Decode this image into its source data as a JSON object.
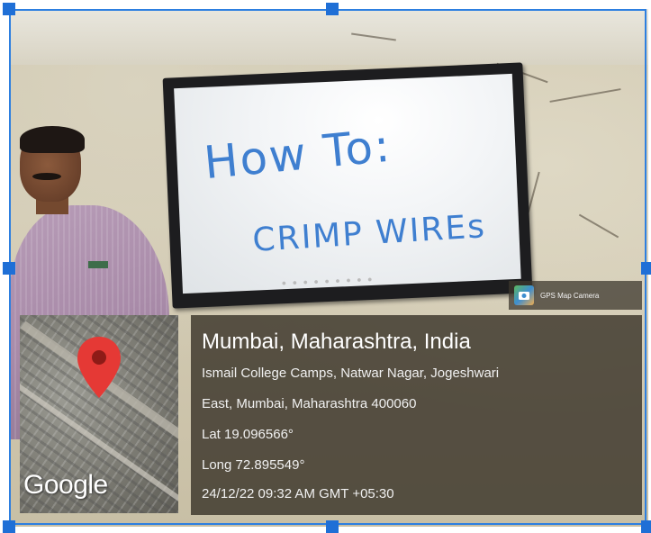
{
  "photo": {
    "whiteboard": {
      "line1": "How To:",
      "line2": "CRIMP WIREs"
    }
  },
  "overlay": {
    "app_badge": {
      "logo_icon": "map-camera-icon",
      "name": "GPS Map Camera"
    },
    "map": {
      "pin_icon": "location-pin-icon",
      "pin_color": "#e53935",
      "brand": "Google"
    },
    "location": {
      "title": "Mumbai, Maharashtra, India",
      "address_line1": "Ismail College Camps, Natwar Nagar, Jogeshwari",
      "address_line2": "East, Mumbai, Maharashtra 400060",
      "lat": "Lat 19.096566°",
      "long": "Long 72.895549°",
      "timestamp": "24/12/22 09:32 AM GMT +05:30"
    }
  },
  "selection": {
    "color": "#1f6fd6"
  }
}
